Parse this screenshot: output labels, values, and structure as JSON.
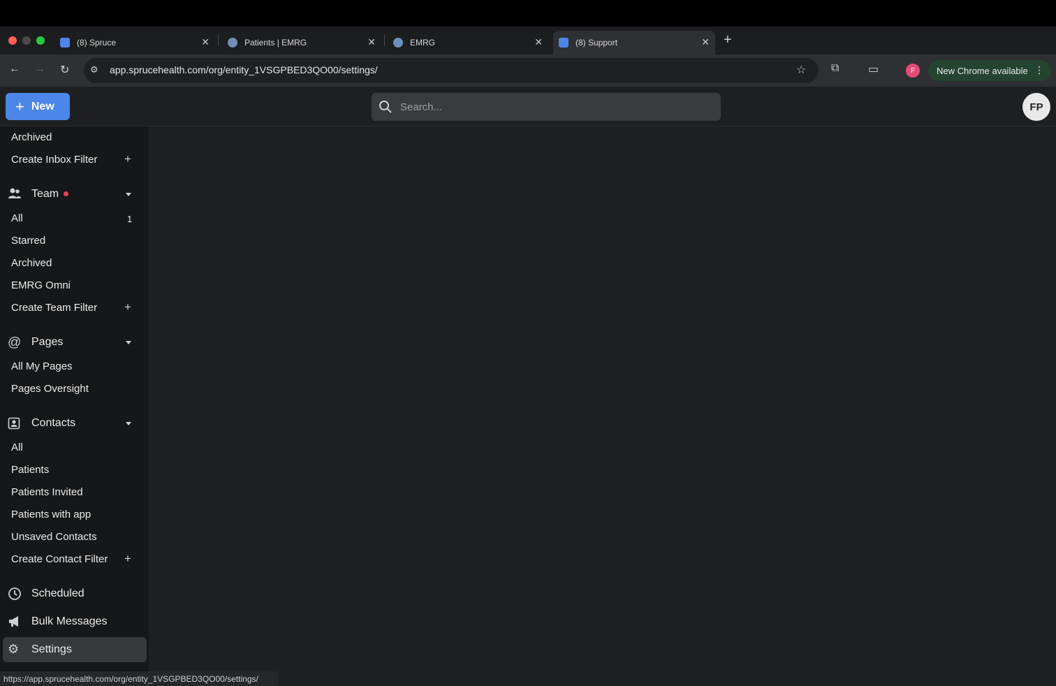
{
  "browser": {
    "tabs": [
      {
        "title": "(8) Spruce",
        "active": false,
        "favicon": "spruce-icon"
      },
      {
        "title": "Patients | EMRG",
        "active": false,
        "favicon": "emrg-icon"
      },
      {
        "title": "EMRG",
        "active": false,
        "favicon": "emrg-icon"
      },
      {
        "title": "(8) Support",
        "active": true,
        "favicon": "spruce-icon"
      }
    ],
    "new_tab_symbol": "+",
    "url": "app.sprucehealth.com/org/entity_1VSGPBED3QO00/settings/",
    "profile_initial": "F",
    "update_label": "New Chrome available",
    "status_url": "https://app.sprucehealth.com/org/entity_1VSGPBED3QO00/settings/"
  },
  "header": {
    "new_label": "New",
    "search_placeholder": "Search...",
    "avatar_initials": "FP"
  },
  "sidebar": {
    "inbox_items": [
      {
        "label": "Archived"
      },
      {
        "label": "Create Inbox Filter",
        "add": true
      }
    ],
    "team": {
      "title": "Team",
      "items": [
        {
          "label": "All",
          "count": "1"
        },
        {
          "label": "Starred"
        },
        {
          "label": "Archived"
        },
        {
          "label": "EMRG Omni"
        },
        {
          "label": "Create Team Filter",
          "add": true
        }
      ]
    },
    "pages": {
      "title": "Pages",
      "items": [
        {
          "label": "All My Pages"
        },
        {
          "label": "Pages Oversight"
        }
      ]
    },
    "contacts": {
      "title": "Contacts",
      "items": [
        {
          "label": "All"
        },
        {
          "label": "Patients"
        },
        {
          "label": "Patients Invited"
        },
        {
          "label": "Patients with app"
        },
        {
          "label": "Unsaved Contacts"
        },
        {
          "label": "Create Contact Filter",
          "add": true
        }
      ]
    },
    "scheduled": "Scheduled",
    "bulk_messages": "Bulk Messages",
    "settings": "Settings"
  },
  "colors": {
    "accent": "#4c86e8",
    "notification_dot": "#e24747",
    "update_pill": "#24442f"
  }
}
